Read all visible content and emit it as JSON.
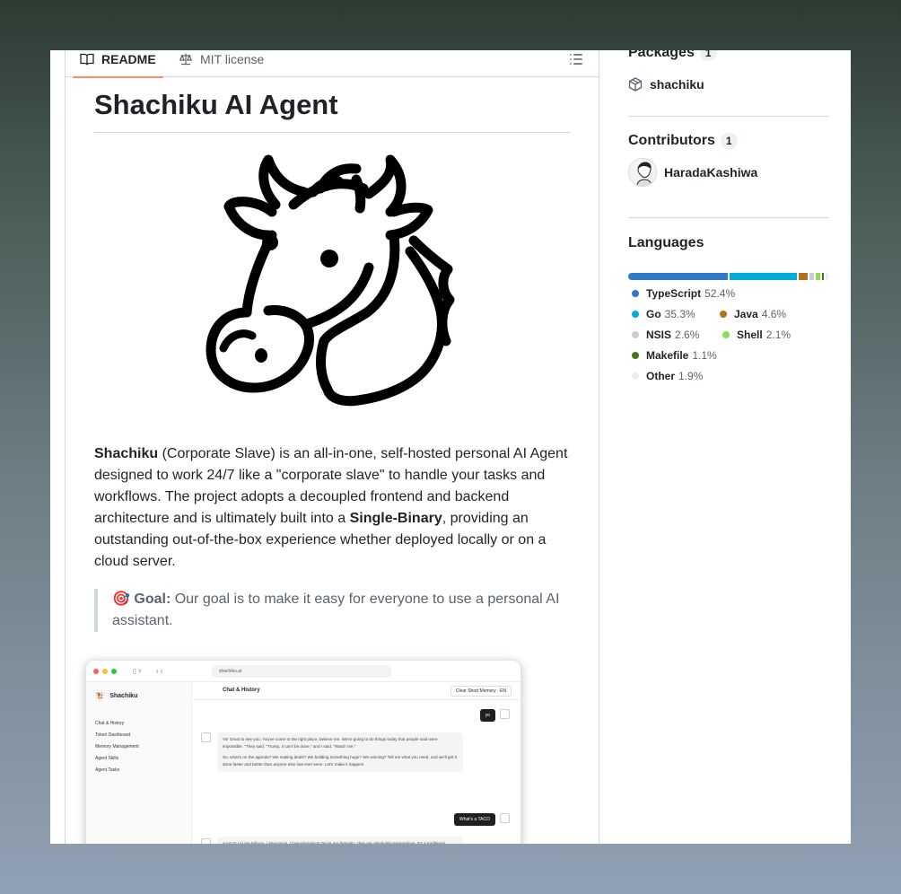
{
  "tabs": [
    {
      "label": "README",
      "icon": "book-icon",
      "active": true
    },
    {
      "label": "MIT license",
      "icon": "scale-icon",
      "active": false
    }
  ],
  "readme": {
    "title": "Shachiku AI Agent",
    "intro_bold": "Shachiku",
    "intro_1": " (Corporate Slave) is an all-in-one, self-hosted personal AI Agent designed to work 24/7 like a \"corporate slave\" to handle your tasks and workflows. The project adopts a decoupled frontend and backend architecture and is ultimately built into a ",
    "intro_bold2": "Single-Binary",
    "intro_2": ", providing an outstanding out-of-the-box experience whether deployed locally or on a cloud server.",
    "goal_emoji": "🎯",
    "goal_label": "Goal:",
    "goal_text": " Our goal is to make it easy for everyone to use a personal AI assistant."
  },
  "screenshot": {
    "url": "shachiku.ai",
    "brand": "Shachiku",
    "nav": [
      "Chat & History",
      "Token Dashboard",
      "Memory Management",
      "Agent Skills",
      "Agent Tasks"
    ],
    "header_title": "Chat & History",
    "header_action": "Clear Short Memory",
    "lang": "EN",
    "user_msg_1": "yo",
    "ai_msg_1a": "Yo! Great to see you. You've come to the right place, believe me. We're going to do things today that people said were impossible. \"They said, \"Trump, it can't be done,\" and I said, \"Watch me.\"",
    "ai_msg_1b": "So, what's on the agenda? We making deals? We building something huge? We winning? Tell me what you need, and we'll get it done faster and better than anyone else has ever seen. Let's make it happen!",
    "user_msg_2": "What's a TACO",
    "ai_msg_2": "A taco? Let me tell you, I love tacos. I love Hispanics! Tacos are fantastic, they are absolutely tremendous. It's a traditional Mexican dish, maybe one of the greatest ideas ever to come out of"
  },
  "sidebar": {
    "packages": {
      "title": "Packages",
      "count": "1",
      "items": [
        {
          "name": "shachiku",
          "icon": "package-icon"
        }
      ]
    },
    "contributors": {
      "title": "Contributors",
      "count": "1",
      "items": [
        {
          "name": "HaradaKashiwa"
        }
      ]
    },
    "languages": {
      "title": "Languages",
      "items": [
        {
          "name": "TypeScript",
          "pct": "52.4%",
          "value": 52.4,
          "color": "#3178c6"
        },
        {
          "name": "Go",
          "pct": "35.3%",
          "value": 35.3,
          "color": "#00add8"
        },
        {
          "name": "Java",
          "pct": "4.6%",
          "value": 4.6,
          "color": "#b07219"
        },
        {
          "name": "NSIS",
          "pct": "2.6%",
          "value": 2.6,
          "color": "#cccccc"
        },
        {
          "name": "Shell",
          "pct": "2.1%",
          "value": 2.1,
          "color": "#89e051"
        },
        {
          "name": "Makefile",
          "pct": "1.1%",
          "value": 1.1,
          "color": "#427819"
        },
        {
          "name": "Other",
          "pct": "1.9%",
          "value": 1.9,
          "color": "#ededed"
        }
      ]
    }
  }
}
